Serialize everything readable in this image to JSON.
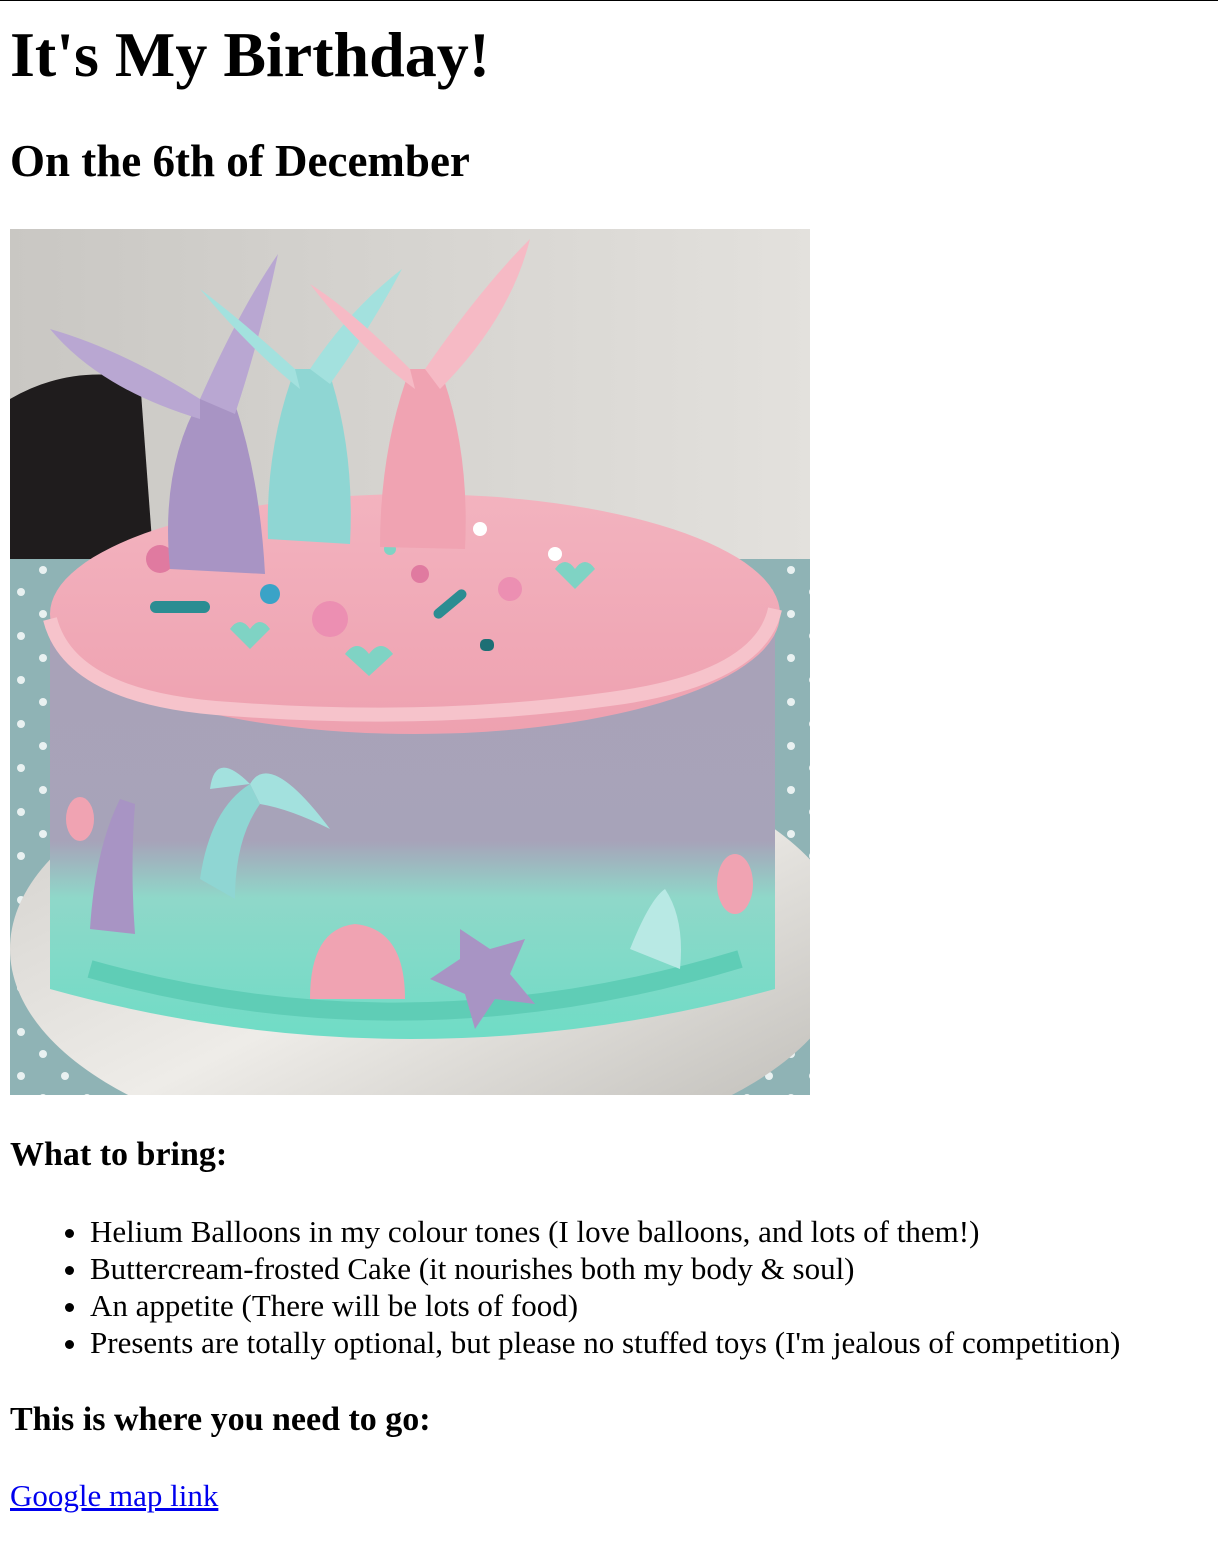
{
  "header": {
    "title": "It's My Birthday!",
    "subtitle": "On the 6th of December"
  },
  "photo": {
    "subject": "mermaid-tail-cake",
    "colors": {
      "frosting_pink": "#f2a9b5",
      "frosting_lilac": "#a9a2b8",
      "frosting_mint": "#7fe0cc",
      "tail_purple": "#a894c4",
      "tail_teal": "#8fd6d3",
      "tail_pink": "#f0a3b2",
      "board": "#d8d6d2",
      "wall": "#e6e4e0"
    }
  },
  "bring": {
    "heading": "What to bring:",
    "items": [
      "Helium Balloons in my colour tones (I love balloons, and lots of them!)",
      "Buttercream-frosted Cake (it nourishes both my body & soul)",
      "An appetite (There will be lots of food)",
      "Presents are totally optional, but please no stuffed toys (I'm jealous of competition)"
    ]
  },
  "location": {
    "heading": "This is where you need to go:",
    "link_text": "Google map link",
    "link_color": "#0000ee"
  }
}
